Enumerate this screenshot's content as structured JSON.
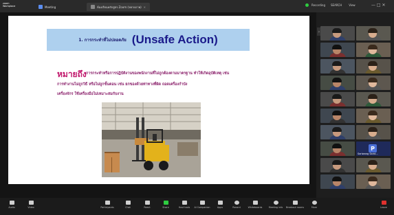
{
  "window": {
    "app_name": "zoom\nWorkplace",
    "tabs": [
      {
        "label": "Meeting"
      },
      {
        "label": "ห้องเรียนหลักสูตร Zoom (ขยายภาพ)"
      }
    ],
    "recording_label": "Recording",
    "search_label": "SEARCH",
    "view_label": "View"
  },
  "slide": {
    "title_thai": "1. การกระทำที่ไม่ปลอดภัย",
    "title_eng": "(Unsafe Action)",
    "def_heading": "หมายถึง",
    "def_lines": [
      "การกระทำหรือการปฏิบัติงานของพนักงานที่ไม่ถูกต้องตามมาตรฐาน ทำให้เกิดอุบัติเหตุ เช่น",
      "การทำงานไม่ถูกวิธี หรือไม่ถูกขั้นตอน เช่น ยกของด้วยท่าทางที่ผิด ถอดเครื่องกำบัง",
      "เครื่องจักร ใช้เครื่องมือไม่เหมาะสมกับงาน"
    ]
  },
  "participants": {
    "tiles": [
      {
        "name": ""
      },
      {
        "name": ""
      },
      {
        "name": ""
      },
      {
        "name": ""
      },
      {
        "name": ""
      },
      {
        "name": ""
      },
      {
        "name": ""
      },
      {
        "name": ""
      },
      {
        "name": ""
      },
      {
        "name": ""
      },
      {
        "name": ""
      },
      {
        "name": ""
      },
      {
        "name": ""
      },
      {
        "name": ""
      },
      {
        "name": ""
      },
      {
        "name": ""
      },
      {
        "name": "Sariwong Sarid..."
      },
      {
        "name": ""
      },
      {
        "name": ""
      },
      {
        "name": ""
      },
      {
        "name": ""
      },
      {
        "name": ""
      }
    ],
    "avatar_letter": "P",
    "avatar_name": "Sariwong Sarid..."
  },
  "toolbar": {
    "audio": "Audio",
    "video": "Video",
    "participants": "Participants",
    "chat": "Chat",
    "react": "React",
    "share": "Share",
    "host_tools": "Host tools",
    "ai_companion": "AI Companion",
    "apps": "Apps",
    "record": "Record",
    "whiteboards": "Whiteboards",
    "meeting_info": "Meeting info",
    "breakout_rooms": "Breakout rooms",
    "more": "More",
    "leave": "Leave"
  },
  "colors": {
    "title_banner": "#aed0ee",
    "title_text": "#1a1a8a",
    "heading_color": "#c0146a",
    "def_text": "#8a1f6a"
  }
}
